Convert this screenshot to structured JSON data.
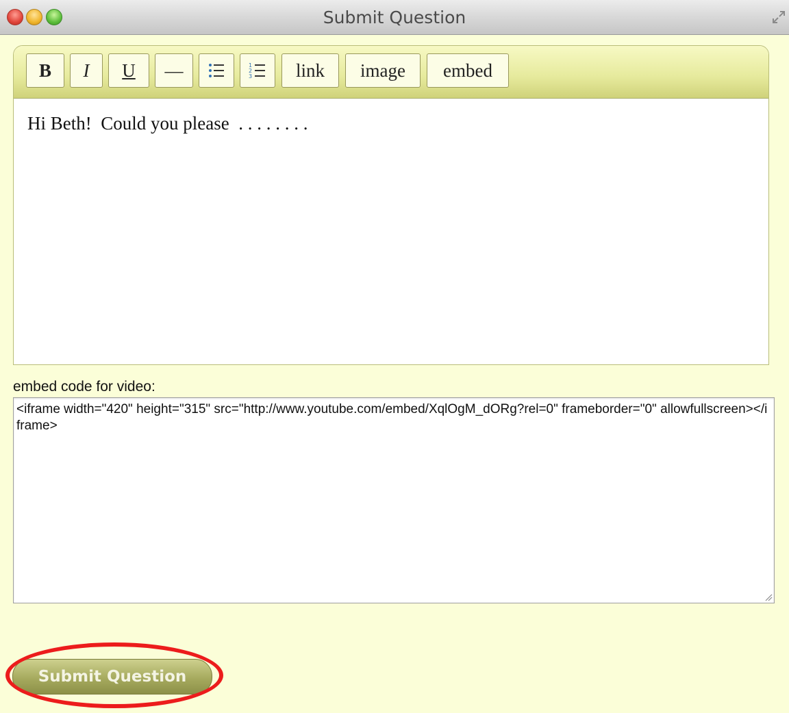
{
  "window": {
    "title": "Submit Question"
  },
  "toolbar": {
    "buttons": [
      {
        "label": "B",
        "icon": "bold-icon"
      },
      {
        "label": "I",
        "icon": "italic-icon"
      },
      {
        "label": "U",
        "icon": "underline-icon"
      },
      {
        "label": "—",
        "icon": "horizontal-rule-icon"
      },
      {
        "label": "",
        "icon": "bulleted-list-icon"
      },
      {
        "label": "",
        "icon": "numbered-list-icon"
      },
      {
        "label": "link"
      },
      {
        "label": "image"
      },
      {
        "label": "embed"
      }
    ]
  },
  "editor": {
    "content": "Hi Beth!  Could you please  . . . . . . . ."
  },
  "embed": {
    "label": "embed code for video:",
    "value": "<iframe width=\"420\" height=\"315\" src=\"http://www.youtube.com/embed/XqlOgM_dORg?rel=0\" frameborder=\"0\" allowfullscreen></iframe>"
  },
  "submit": {
    "label": "Submit Question"
  },
  "colors": {
    "background": "#fbfed8",
    "toolbar": "#e6ea9c",
    "button": "#a6aa5e",
    "highlight": "#ec1c1c"
  }
}
